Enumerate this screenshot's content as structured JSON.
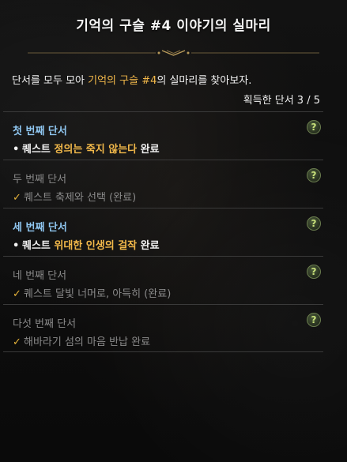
{
  "header": {
    "title": "기억의 구슬 #4 이야기의 실마리"
  },
  "intro": {
    "prefix": "단서를 모두 모아 ",
    "highlight": "기억의 구슬 #4",
    "suffix": "의 실마리를 찾아보자.",
    "progress": "획득한 단서 3 / 5"
  },
  "colors": {
    "highlight": "#f3b94a",
    "active_title": "#8fc6f0",
    "done_text": "#8a8a8a",
    "check": "#e7b43a"
  },
  "clues": [
    {
      "title": "첫 번째 단서",
      "state": "active",
      "marker": "•",
      "desc_before": "퀘스트 ",
      "desc_highlight": "정의는 죽지 않는다",
      "desc_after": " 완료",
      "help": "?"
    },
    {
      "title": "두 번째 단서",
      "state": "done",
      "marker": "✓",
      "desc": "퀘스트 축제와 선택 (완료)",
      "help": "?"
    },
    {
      "title": "세 번째 단서",
      "state": "active",
      "marker": "•",
      "desc_before": "퀘스트 ",
      "desc_highlight": "위대한 인생의 걸작",
      "desc_after": " 완료",
      "help": "?"
    },
    {
      "title": "네 번째 단서",
      "state": "done",
      "marker": "✓",
      "desc": "퀘스트 달빛 너머로, 아득히 (완료)",
      "help": "?"
    },
    {
      "title": "다섯 번째 단서",
      "state": "done",
      "marker": "✓",
      "desc": "해바라기 섬의 마음 반납 완료",
      "help": "?"
    }
  ]
}
